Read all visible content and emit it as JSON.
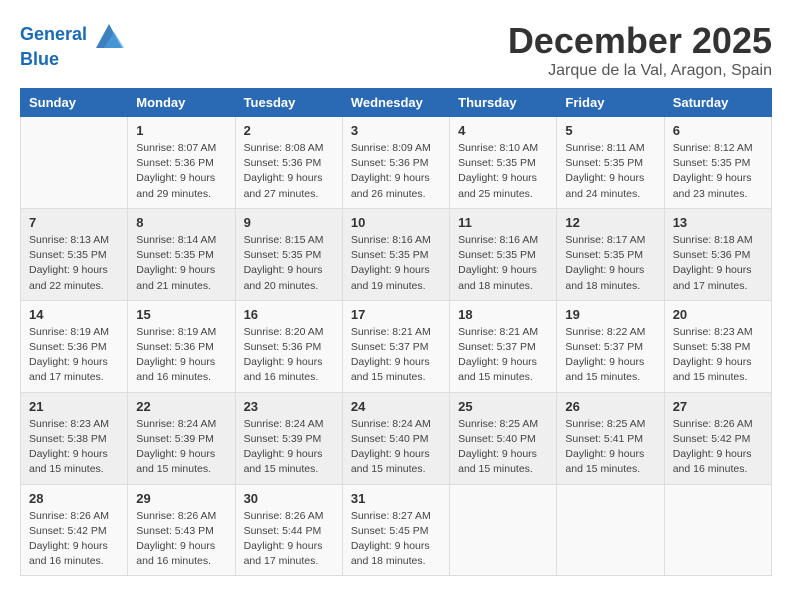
{
  "header": {
    "logo_line1": "General",
    "logo_line2": "Blue",
    "month_title": "December 2025",
    "location": "Jarque de la Val, Aragon, Spain"
  },
  "weekdays": [
    "Sunday",
    "Monday",
    "Tuesday",
    "Wednesday",
    "Thursday",
    "Friday",
    "Saturday"
  ],
  "weeks": [
    [
      {
        "day": "",
        "sunrise": "",
        "sunset": "",
        "daylight": ""
      },
      {
        "day": "1",
        "sunrise": "Sunrise: 8:07 AM",
        "sunset": "Sunset: 5:36 PM",
        "daylight": "Daylight: 9 hours and 29 minutes."
      },
      {
        "day": "2",
        "sunrise": "Sunrise: 8:08 AM",
        "sunset": "Sunset: 5:36 PM",
        "daylight": "Daylight: 9 hours and 27 minutes."
      },
      {
        "day": "3",
        "sunrise": "Sunrise: 8:09 AM",
        "sunset": "Sunset: 5:36 PM",
        "daylight": "Daylight: 9 hours and 26 minutes."
      },
      {
        "day": "4",
        "sunrise": "Sunrise: 8:10 AM",
        "sunset": "Sunset: 5:35 PM",
        "daylight": "Daylight: 9 hours and 25 minutes."
      },
      {
        "day": "5",
        "sunrise": "Sunrise: 8:11 AM",
        "sunset": "Sunset: 5:35 PM",
        "daylight": "Daylight: 9 hours and 24 minutes."
      },
      {
        "day": "6",
        "sunrise": "Sunrise: 8:12 AM",
        "sunset": "Sunset: 5:35 PM",
        "daylight": "Daylight: 9 hours and 23 minutes."
      }
    ],
    [
      {
        "day": "7",
        "sunrise": "Sunrise: 8:13 AM",
        "sunset": "Sunset: 5:35 PM",
        "daylight": "Daylight: 9 hours and 22 minutes."
      },
      {
        "day": "8",
        "sunrise": "Sunrise: 8:14 AM",
        "sunset": "Sunset: 5:35 PM",
        "daylight": "Daylight: 9 hours and 21 minutes."
      },
      {
        "day": "9",
        "sunrise": "Sunrise: 8:15 AM",
        "sunset": "Sunset: 5:35 PM",
        "daylight": "Daylight: 9 hours and 20 minutes."
      },
      {
        "day": "10",
        "sunrise": "Sunrise: 8:16 AM",
        "sunset": "Sunset: 5:35 PM",
        "daylight": "Daylight: 9 hours and 19 minutes."
      },
      {
        "day": "11",
        "sunrise": "Sunrise: 8:16 AM",
        "sunset": "Sunset: 5:35 PM",
        "daylight": "Daylight: 9 hours and 18 minutes."
      },
      {
        "day": "12",
        "sunrise": "Sunrise: 8:17 AM",
        "sunset": "Sunset: 5:35 PM",
        "daylight": "Daylight: 9 hours and 18 minutes."
      },
      {
        "day": "13",
        "sunrise": "Sunrise: 8:18 AM",
        "sunset": "Sunset: 5:36 PM",
        "daylight": "Daylight: 9 hours and 17 minutes."
      }
    ],
    [
      {
        "day": "14",
        "sunrise": "Sunrise: 8:19 AM",
        "sunset": "Sunset: 5:36 PM",
        "daylight": "Daylight: 9 hours and 17 minutes."
      },
      {
        "day": "15",
        "sunrise": "Sunrise: 8:19 AM",
        "sunset": "Sunset: 5:36 PM",
        "daylight": "Daylight: 9 hours and 16 minutes."
      },
      {
        "day": "16",
        "sunrise": "Sunrise: 8:20 AM",
        "sunset": "Sunset: 5:36 PM",
        "daylight": "Daylight: 9 hours and 16 minutes."
      },
      {
        "day": "17",
        "sunrise": "Sunrise: 8:21 AM",
        "sunset": "Sunset: 5:37 PM",
        "daylight": "Daylight: 9 hours and 15 minutes."
      },
      {
        "day": "18",
        "sunrise": "Sunrise: 8:21 AM",
        "sunset": "Sunset: 5:37 PM",
        "daylight": "Daylight: 9 hours and 15 minutes."
      },
      {
        "day": "19",
        "sunrise": "Sunrise: 8:22 AM",
        "sunset": "Sunset: 5:37 PM",
        "daylight": "Daylight: 9 hours and 15 minutes."
      },
      {
        "day": "20",
        "sunrise": "Sunrise: 8:23 AM",
        "sunset": "Sunset: 5:38 PM",
        "daylight": "Daylight: 9 hours and 15 minutes."
      }
    ],
    [
      {
        "day": "21",
        "sunrise": "Sunrise: 8:23 AM",
        "sunset": "Sunset: 5:38 PM",
        "daylight": "Daylight: 9 hours and 15 minutes."
      },
      {
        "day": "22",
        "sunrise": "Sunrise: 8:24 AM",
        "sunset": "Sunset: 5:39 PM",
        "daylight": "Daylight: 9 hours and 15 minutes."
      },
      {
        "day": "23",
        "sunrise": "Sunrise: 8:24 AM",
        "sunset": "Sunset: 5:39 PM",
        "daylight": "Daylight: 9 hours and 15 minutes."
      },
      {
        "day": "24",
        "sunrise": "Sunrise: 8:24 AM",
        "sunset": "Sunset: 5:40 PM",
        "daylight": "Daylight: 9 hours and 15 minutes."
      },
      {
        "day": "25",
        "sunrise": "Sunrise: 8:25 AM",
        "sunset": "Sunset: 5:40 PM",
        "daylight": "Daylight: 9 hours and 15 minutes."
      },
      {
        "day": "26",
        "sunrise": "Sunrise: 8:25 AM",
        "sunset": "Sunset: 5:41 PM",
        "daylight": "Daylight: 9 hours and 15 minutes."
      },
      {
        "day": "27",
        "sunrise": "Sunrise: 8:26 AM",
        "sunset": "Sunset: 5:42 PM",
        "daylight": "Daylight: 9 hours and 16 minutes."
      }
    ],
    [
      {
        "day": "28",
        "sunrise": "Sunrise: 8:26 AM",
        "sunset": "Sunset: 5:42 PM",
        "daylight": "Daylight: 9 hours and 16 minutes."
      },
      {
        "day": "29",
        "sunrise": "Sunrise: 8:26 AM",
        "sunset": "Sunset: 5:43 PM",
        "daylight": "Daylight: 9 hours and 16 minutes."
      },
      {
        "day": "30",
        "sunrise": "Sunrise: 8:26 AM",
        "sunset": "Sunset: 5:44 PM",
        "daylight": "Daylight: 9 hours and 17 minutes."
      },
      {
        "day": "31",
        "sunrise": "Sunrise: 8:27 AM",
        "sunset": "Sunset: 5:45 PM",
        "daylight": "Daylight: 9 hours and 18 minutes."
      },
      {
        "day": "",
        "sunrise": "",
        "sunset": "",
        "daylight": ""
      },
      {
        "day": "",
        "sunrise": "",
        "sunset": "",
        "daylight": ""
      },
      {
        "day": "",
        "sunrise": "",
        "sunset": "",
        "daylight": ""
      }
    ]
  ]
}
